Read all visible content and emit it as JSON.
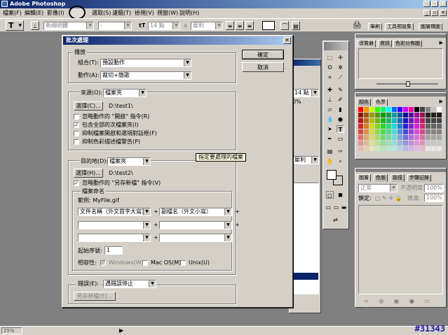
{
  "app": {
    "title": "Adobe Photoshop",
    "menu": [
      "檔案(F)",
      "編輯(E)",
      "影像(I)",
      "圖層(L)",
      "選取(S)",
      "濾鏡(T)",
      "檢視(V)",
      "視窗(W)",
      "說明(H)"
    ]
  },
  "options_bar": {
    "tool_glyph": "T",
    "font_family": "新細明體",
    "font_size": "14 點",
    "antialias_label": "a",
    "antialias_value": "犀利",
    "right_tabs": [
      "筆刷",
      "工具預設集",
      "圖層構圖"
    ]
  },
  "dialog": {
    "title": "批次處理",
    "ok": "確定",
    "cancel": "取消",
    "play": {
      "group": "播放",
      "set_label": "組合(T):",
      "set_value": "預設動作",
      "action_label": "動作(A):",
      "action_value": "裁切+簡歌"
    },
    "source": {
      "label": "來源(O):",
      "value": "檔案夾",
      "choose": "選擇(C)...",
      "path": "D:\\test1\\",
      "options": [
        {
          "label": "忽略動作的 \"開啟\" 指令(R)",
          "checked": false
        },
        {
          "label": "包含全部的次檔案夾(I)",
          "checked": true
        },
        {
          "label": "抑制檔案開啟和選項對話框(F)",
          "checked": false
        },
        {
          "label": "抑制色彩描述檔警告(P)",
          "checked": false
        }
      ]
    },
    "destination": {
      "label": "目的地(D):",
      "value": "檔案夾",
      "tooltip": "指定要處理的檔案",
      "choose": "選擇(H)...",
      "path": "D:\\test2\\",
      "override_label": "忽略動作的 \"另存新檔\" 指令(V)",
      "override_checked": true,
      "naming_group": "檔案命名",
      "example": "範例: MyFile.gif",
      "naming_fields": [
        "文件名稱（外文首字大寫）",
        "副檔名（外文小寫）",
        "",
        "",
        "",
        ""
      ],
      "serial_label": "起始序號:",
      "serial_value": "1",
      "compat_label": "相容性:",
      "compat": [
        {
          "label": "Windows(W)",
          "checked": true,
          "disabled": true
        },
        {
          "label": "Mac OS(M)",
          "checked": false,
          "disabled": false
        },
        {
          "label": "Unix(U)",
          "checked": false,
          "disabled": false
        }
      ]
    },
    "errors": {
      "label": "錯誤(E):",
      "value": "遇錯誤停止",
      "save_as": "另存新檔(E)..."
    }
  },
  "navigator_panel": {
    "tabs": [
      "導覽器",
      "資訊",
      "色彩分佈圖"
    ]
  },
  "swatches_panel": {
    "tabs": [
      "顏色",
      "色票"
    ]
  },
  "layers_panel": {
    "tabs": [
      "圖層",
      "色版",
      "路徑",
      "步驟記錄"
    ],
    "blend": "正常",
    "opacity_label": "不透明度:",
    "opacity": "100%",
    "lock_label": "鎖定:",
    "fill_label": "填滿:",
    "fill": "100%"
  },
  "background_doc": {
    "size": "14 點",
    "zoom_partial": "0%",
    "sharp": "犀利"
  },
  "status_bar": {
    "zoom": "25%",
    "play_glyph": "▶"
  },
  "watermark": "#31343",
  "colors": {
    "desktop": "#808080",
    "face": "#d4d0c8",
    "title_start": "#0a246a",
    "title_end": "#a6caf0",
    "watermark": "#1a1aa8"
  }
}
